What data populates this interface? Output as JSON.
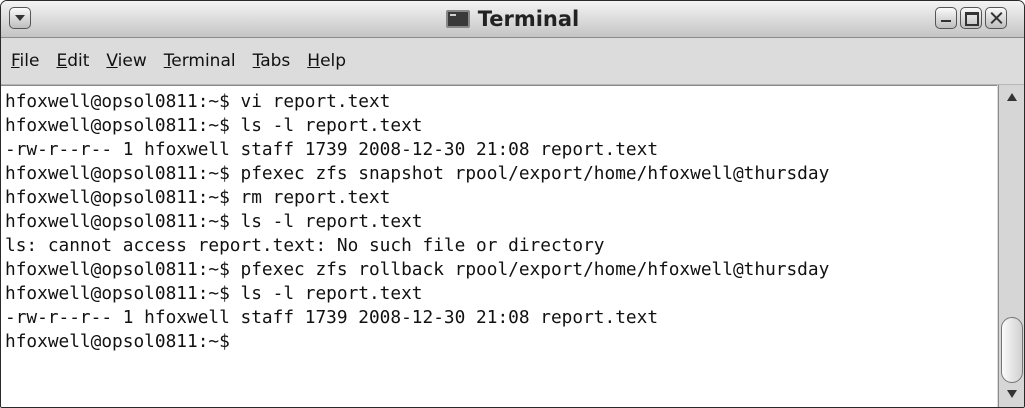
{
  "window": {
    "title": "Terminal"
  },
  "menu": [
    {
      "mnemonic": "F",
      "rest": "ile"
    },
    {
      "mnemonic": "E",
      "rest": "dit"
    },
    {
      "mnemonic": "V",
      "rest": "iew"
    },
    {
      "mnemonic": "T",
      "rest": "erminal"
    },
    {
      "mnemonic": "T",
      "rest": "abs"
    },
    {
      "mnemonic": "H",
      "rest": "elp"
    }
  ],
  "terminal": {
    "lines": [
      "hfoxwell@opsol0811:~$ vi report.text",
      "hfoxwell@opsol0811:~$ ls -l report.text",
      "-rw-r--r-- 1 hfoxwell staff 1739 2008-12-30 21:08 report.text",
      "hfoxwell@opsol0811:~$ pfexec zfs snapshot rpool/export/home/hfoxwell@thursday",
      "hfoxwell@opsol0811:~$ rm report.text",
      "hfoxwell@opsol0811:~$ ls -l report.text",
      "ls: cannot access report.text: No such file or directory",
      "hfoxwell@opsol0811:~$ pfexec zfs rollback rpool/export/home/hfoxwell@thursday",
      "hfoxwell@opsol0811:~$ ls -l report.text",
      "-rw-r--r-- 1 hfoxwell staff 1739 2008-12-30 21:08 report.text",
      "hfoxwell@opsol0811:~$"
    ]
  },
  "icons": {
    "window_menu": "window-menu-icon",
    "minimize": "minimize-icon",
    "maximize": "maximize-icon",
    "close": "close-icon",
    "terminal": "terminal-icon",
    "scroll_up": "scroll-up-arrow-icon",
    "scroll_down": "scroll-down-arrow-icon"
  }
}
